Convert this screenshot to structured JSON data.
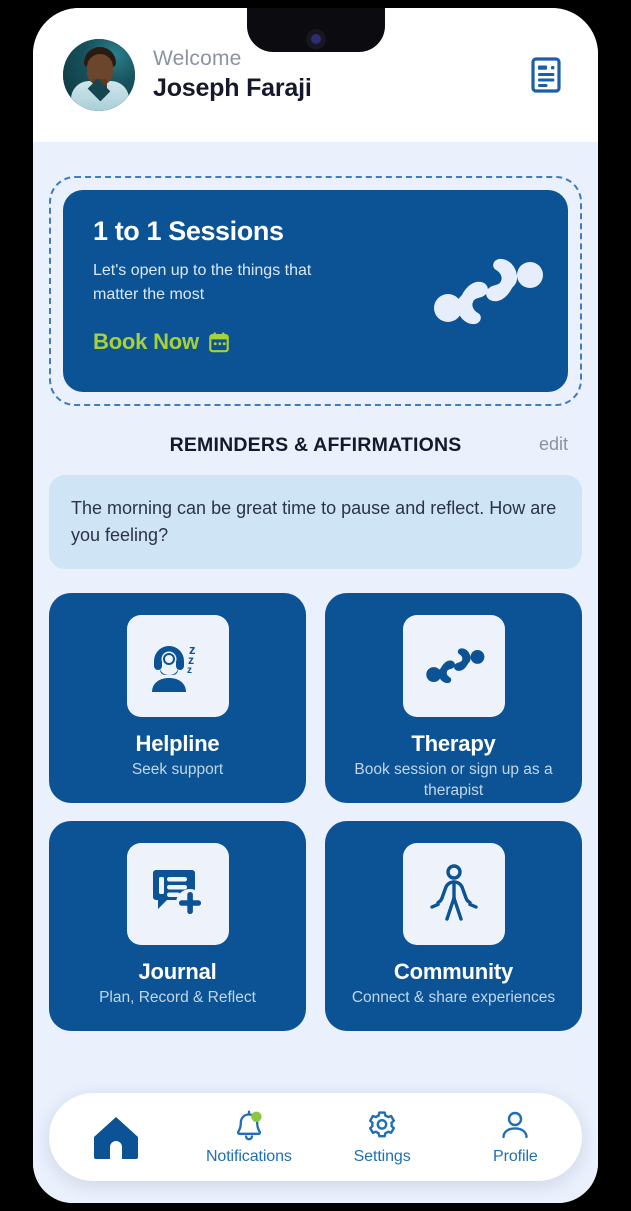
{
  "header": {
    "welcome_label": "Welcome",
    "user_name": "Joseph Faraji",
    "avatar_name": "user-avatar",
    "doc_icon": "document-icon"
  },
  "banner": {
    "title": "1 to 1 Sessions",
    "subtitle": "Let's open up to the things that matter the most",
    "cta_label": "Book Now",
    "cta_icon": "calendar-icon",
    "art_icon": "therapy-figures-icon",
    "bg_color": "#0b5394",
    "cta_color": "#a8d137",
    "dash_border_color": "#3f7cc0"
  },
  "reminders": {
    "section_title": "REMINDERS & AFFIRMATIONS",
    "edit_label": "edit",
    "affirmation_text": "The morning can be great time to pause and reflect. How are you feeling?",
    "affirmation_bg": "#cfe4f5"
  },
  "tiles": [
    {
      "title": "Helpline",
      "subtitle": "Seek support",
      "icon": "support-headset-sleep-icon",
      "name": "tile-helpline"
    },
    {
      "title": "Therapy",
      "subtitle": "Book session or sign up as a therapist",
      "icon": "therapy-figures-icon",
      "name": "tile-therapy"
    },
    {
      "title": "Journal",
      "subtitle": "Plan, Record  & Reflect",
      "icon": "note-add-icon",
      "name": "tile-journal"
    },
    {
      "title": "Community",
      "subtitle": "Connect & share experiences",
      "icon": "person-open-arms-icon",
      "name": "tile-community"
    }
  ],
  "bottom_nav": [
    {
      "label": "",
      "icon": "home-icon",
      "name": "nav-home",
      "active": true
    },
    {
      "label": "Notifications",
      "icon": "bell-icon",
      "name": "nav-notifications",
      "badge_color": "#8dc63f"
    },
    {
      "label": "Settings",
      "icon": "gear-icon",
      "name": "nav-settings"
    },
    {
      "label": "Profile",
      "icon": "person-icon",
      "name": "nav-profile"
    }
  ],
  "theme": {
    "screen_bg": "#eaf0fc",
    "primary_blue": "#0b5394",
    "nav_blue": "#1f6fb4",
    "accent_green": "#a8d137"
  }
}
